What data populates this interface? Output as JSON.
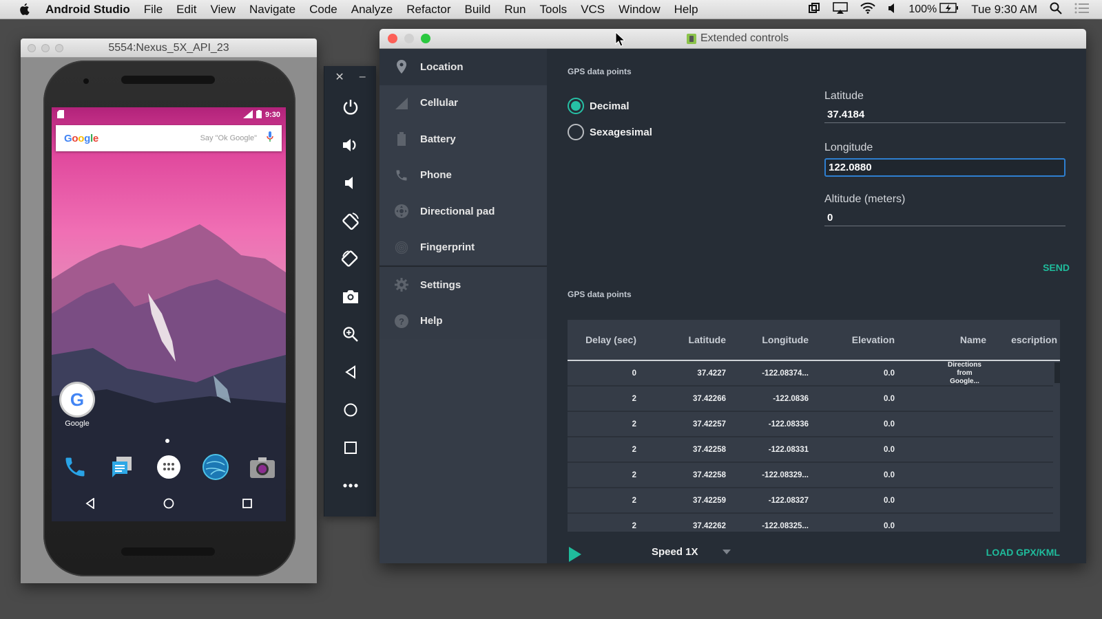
{
  "menubar": {
    "app_name": "Android Studio",
    "items": [
      "File",
      "Edit",
      "View",
      "Navigate",
      "Code",
      "Analyze",
      "Refactor",
      "Build",
      "Run",
      "Tools",
      "VCS",
      "Window",
      "Help"
    ],
    "battery": "100%",
    "clock": "Tue 9:30 AM",
    "status_icons": [
      "screen-mirror-icon",
      "airplay-icon",
      "wifi-icon",
      "volume-icon",
      "battery-charging-icon",
      "spotlight-search-icon",
      "notification-center-icon"
    ]
  },
  "emulator": {
    "title": "5554:Nexus_5X_API_23",
    "status_time": "9:30",
    "search_logo": "Google",
    "search_hint": "Say \"Ok Google\"",
    "home_app_label": "Google",
    "dock_apps": [
      "phone-icon",
      "messages-icon",
      "app-drawer-icon",
      "browser-icon",
      "camera-icon"
    ],
    "nav": [
      "back-icon",
      "home-icon",
      "recents-icon"
    ]
  },
  "toolbar": {
    "buttons": [
      "power",
      "volume-up",
      "volume-down",
      "rotate-left",
      "rotate-right",
      "screenshot",
      "zoom",
      "back",
      "home",
      "overview",
      "more"
    ]
  },
  "extended_controls": {
    "title": "Extended controls",
    "nav": [
      {
        "label": "Location",
        "icon": "location-pin-icon",
        "active": true
      },
      {
        "label": "Cellular",
        "icon": "cellular-icon"
      },
      {
        "label": "Battery",
        "icon": "battery-icon"
      },
      {
        "label": "Phone",
        "icon": "phone-icon"
      },
      {
        "label": "Directional pad",
        "icon": "dpad-icon"
      },
      {
        "label": "Fingerprint",
        "icon": "fingerprint-icon"
      }
    ],
    "nav_bottom": [
      {
        "label": "Settings",
        "icon": "gear-icon"
      },
      {
        "label": "Help",
        "icon": "help-icon"
      }
    ],
    "gps_label_top": "GPS data points",
    "format_options": [
      {
        "label": "Decimal",
        "selected": true
      },
      {
        "label": "Sexagesimal",
        "selected": false
      }
    ],
    "latitude": {
      "label": "Latitude",
      "value": "37.4184"
    },
    "longitude": {
      "label": "Longitude",
      "value": "122.0880"
    },
    "altitude": {
      "label": "Altitude (meters)",
      "value": "0"
    },
    "send_label": "SEND",
    "gps_label_table": "GPS data points",
    "table": {
      "columns": [
        "Delay (sec)",
        "Latitude",
        "Longitude",
        "Elevation",
        "Name",
        "escription"
      ],
      "rows": [
        [
          "0",
          "37.4227",
          "-122.08374...",
          "0.0",
          "Directions from Google...",
          ""
        ],
        [
          "2",
          "37.42266",
          "-122.0836",
          "0.0",
          "",
          ""
        ],
        [
          "2",
          "37.42257",
          "-122.08336",
          "0.0",
          "",
          ""
        ],
        [
          "2",
          "37.42258",
          "-122.08331",
          "0.0",
          "",
          ""
        ],
        [
          "2",
          "37.42258",
          "-122.08329...",
          "0.0",
          "",
          ""
        ],
        [
          "2",
          "37.42259",
          "-122.08327",
          "0.0",
          "",
          ""
        ],
        [
          "2",
          "37.42262",
          "-122.08325...",
          "0.0",
          "",
          ""
        ]
      ]
    },
    "speed": "Speed 1X",
    "load_label": "LOAD GPX/KML",
    "accent_color": "#1fbc9c"
  }
}
